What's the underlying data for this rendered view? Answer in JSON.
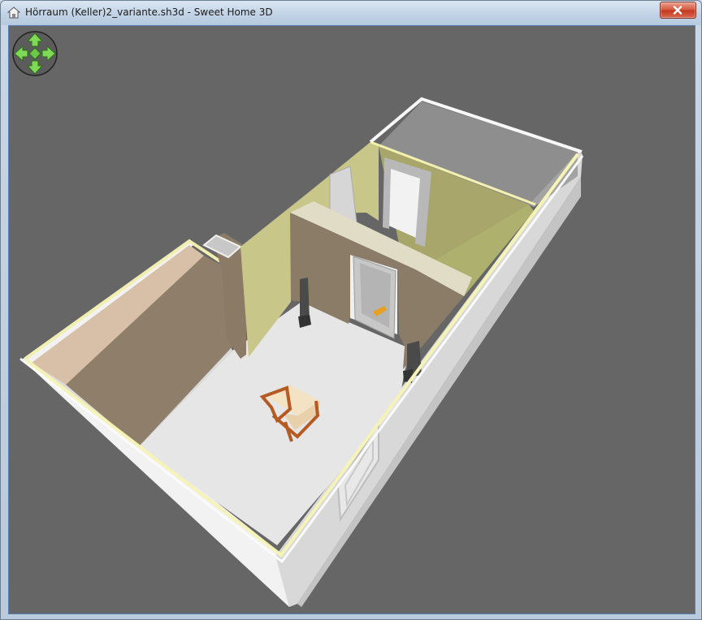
{
  "window": {
    "title": "Hörraum (Keller)2_variante.sh3d - Sweet Home 3D",
    "app_icon": "sweet-home-3d-icon",
    "close_icon": "close-icon"
  },
  "view3d": {
    "navigator": {
      "icons": [
        "arrow-up-icon",
        "arrow-down-icon",
        "arrow-left-icon",
        "arrow-right-icon",
        "center-diamond-icon"
      ]
    },
    "colors": {
      "background": "#666666",
      "floor": "#e8e8e8",
      "wall_top": "#f4f1c8",
      "beige_wall": "#cfcc90",
      "brick_wall": "#8a7c68",
      "door": "#d8d8d8"
    }
  }
}
